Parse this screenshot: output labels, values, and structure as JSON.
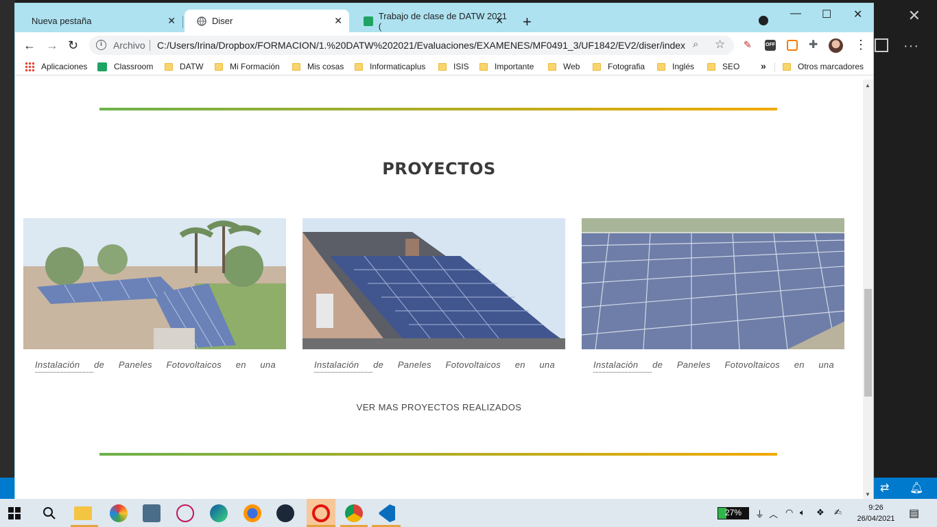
{
  "browser": {
    "tabs": [
      {
        "label": "Nueva pestaña"
      },
      {
        "label": "Diser"
      },
      {
        "label": "Trabajo de clase de DATW 2021 ("
      }
    ],
    "address": {
      "scheme": "Archivo",
      "url": "C:/Users/Irina/Dropbox/FORMACION/1.%20DATW%202021/Evaluaciones/EXAMENES/MF0491_3/UF1842/EV2/diser/index...."
    },
    "extensions": {
      "off_label": "OFF"
    },
    "bookmarks": [
      {
        "label": "Aplicaciones",
        "icon": "apps-grid-icon"
      },
      {
        "label": "Classroom",
        "icon": "classroom-icon"
      },
      {
        "label": "DATW",
        "icon": "folder-icon"
      },
      {
        "label": "Mi Formación",
        "icon": "folder-icon"
      },
      {
        "label": "Mis cosas",
        "icon": "folder-icon"
      },
      {
        "label": "Informaticaplus",
        "icon": "folder-icon"
      },
      {
        "label": "ISIS",
        "icon": "folder-icon"
      },
      {
        "label": "Importante",
        "icon": "folder-icon"
      },
      {
        "label": "Web",
        "icon": "folder-icon"
      },
      {
        "label": "Fotografia",
        "icon": "folder-icon"
      },
      {
        "label": "Inglés",
        "icon": "folder-icon"
      },
      {
        "label": "SEO",
        "icon": "folder-icon"
      }
    ],
    "bookmarks_more": "»",
    "other_bookmarks": "Otros marcadores"
  },
  "page": {
    "section_title": "PROYECTOS",
    "projects": [
      {
        "caption": "Instalación de Paneles Fotovoltaicos en una"
      },
      {
        "caption": "Instalación de Paneles Fotovoltaicos en una"
      },
      {
        "caption": "Instalación de Paneles Fotovoltaicos en una"
      }
    ],
    "more_link": "VER MAS PROYECTOS REALIZADOS",
    "colors": {
      "divider_start": "#6cb14a",
      "divider_end": "#f2a900",
      "text": "#3a3a3a"
    }
  },
  "taskbar": {
    "battery": "27%",
    "time": "9:26",
    "date": "26/04/2021"
  }
}
